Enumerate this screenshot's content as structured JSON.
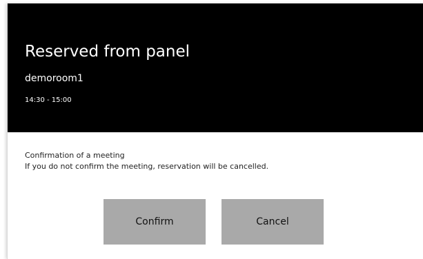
{
  "header": {
    "title": "Reserved from panel",
    "room": "demoroom1",
    "time": "14:30 - 15:00"
  },
  "body": {
    "message_title": "Confirmation of a meeting",
    "message_detail": "If you do not confirm the meeting, reservation will be cancelled."
  },
  "actions": {
    "confirm_label": "Confirm",
    "cancel_label": "Cancel"
  },
  "colors": {
    "header_bg": "#000000",
    "button_bg": "#a9a9a9",
    "body_bg": "#ffffff"
  }
}
